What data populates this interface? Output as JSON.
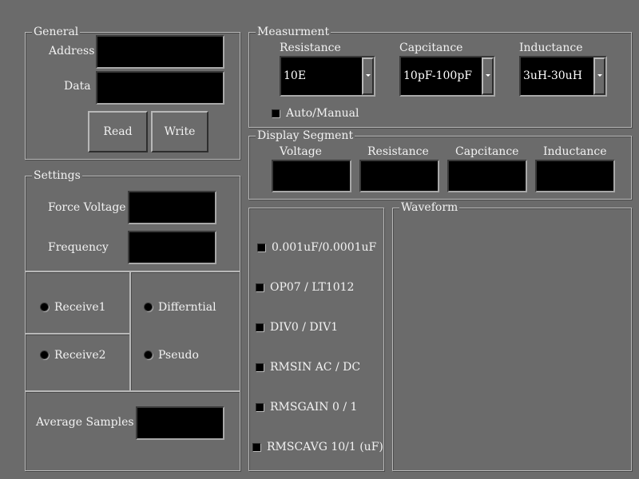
{
  "general": {
    "title": "General",
    "address_label": "Address",
    "data_label": "Data",
    "read_button": "Read",
    "write_button": "Write"
  },
  "settings": {
    "title": "Settings",
    "force_voltage_label": "Force Voltage",
    "frequency_label": "Frequency",
    "receive1": "Receive1",
    "receive2": "Receive2",
    "differential": "Differntial",
    "pseudo": "Pseudo",
    "average_samples_label": "Average Samples"
  },
  "measurement": {
    "title": "Measurment",
    "resistance_label": "Resistance",
    "resistance_value": "10E",
    "capacitance_label": "Capcitance",
    "capacitance_value": "10pF-100pF",
    "inductance_label": "Inductance",
    "inductance_value": "3uH-30uH",
    "auto_manual": "Auto/Manual"
  },
  "display_segment": {
    "title": "Display Segment",
    "voltage": "Voltage",
    "resistance": "Resistance",
    "capacitance": "Capcitance",
    "inductance": "Inductance"
  },
  "options": {
    "opt1": "0.001uF/0.0001uF",
    "opt2": "OP07 / LT1012",
    "opt3": "DIV0 / DIV1",
    "opt4": "RMSIN AC / DC",
    "opt5": "RMSGAIN 0 / 1",
    "opt6": "RMSCAVG 10/1 (uF)"
  },
  "waveform": {
    "title": "Waveform"
  }
}
